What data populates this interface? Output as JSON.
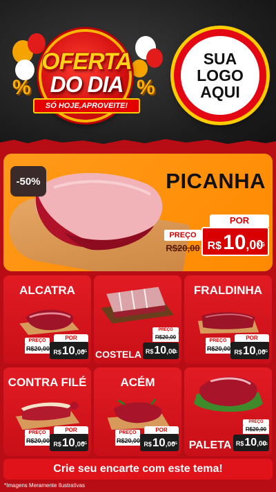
{
  "header": {
    "badge": {
      "title_line1": "OFERTA",
      "title_line2": "DO DIA",
      "ribbon": "SÓ HOJE,APROVEITE!",
      "percent_symbol": "%"
    },
    "logo": {
      "line1": "SUA",
      "line2": "LOGO",
      "line3": "AQUI"
    }
  },
  "hero": {
    "discount": "-50%",
    "name": "PICANHA",
    "price": {
      "por_label": "POR",
      "preco_label": "PREÇO",
      "old": "R$20,00",
      "currency": "R$",
      "integer": "10",
      "cents": ",00",
      "unit": "KG"
    }
  },
  "products": [
    {
      "name": "ALCATRA",
      "preco_label": "PREÇO",
      "por_label": "POR",
      "old": "R$20,00",
      "currency": "R$",
      "integer": "10",
      "cents": ",00",
      "unit": "KG"
    },
    {
      "name": "COSTELA",
      "preco_label": "PREÇO",
      "por_label": "POR",
      "old": "R$20,00",
      "currency": "R$",
      "integer": "10",
      "cents": ",00",
      "unit": "KG"
    },
    {
      "name": "FRALDINHA",
      "preco_label": "PREÇO",
      "por_label": "POR",
      "old": "R$20,00",
      "currency": "R$",
      "integer": "10",
      "cents": ",00",
      "unit": "KG"
    },
    {
      "name": "CONTRA FILÉ",
      "preco_label": "PREÇO",
      "por_label": "POR",
      "old": "R$20,00",
      "currency": "R$",
      "integer": "10",
      "cents": ",00",
      "unit": "KG"
    },
    {
      "name": "ACÉM",
      "preco_label": "PREÇO",
      "por_label": "POR",
      "old": "R$20,00",
      "currency": "R$",
      "integer": "10",
      "cents": ",00",
      "unit": "KG"
    },
    {
      "name": "PALETA",
      "preco_label": "PREÇO",
      "por_label": "POR",
      "old": "R$20,00",
      "currency": "R$",
      "integer": "10",
      "cents": ",00",
      "unit": "KG"
    }
  ],
  "footer": {
    "cta": "Crie seu encarte com este tema!",
    "disclaimer": "*Imagens Meramente Ilustrativas"
  },
  "colors": {
    "background": "#1a1a1a",
    "panel_red": "#b80d14",
    "card_red": "#e21b23",
    "hero_orange": "#ff9a1a",
    "badge_yellow": "#ffd21a"
  }
}
